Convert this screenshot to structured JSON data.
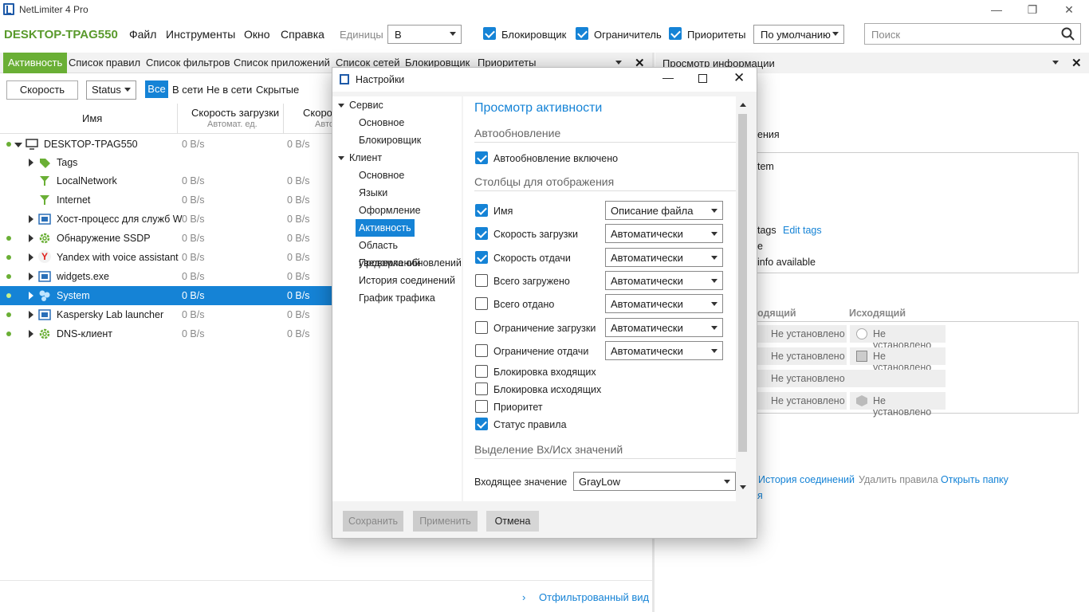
{
  "window": {
    "title": "NetLimiter 4 Pro",
    "min": "—",
    "restore": "❐",
    "close": "✕"
  },
  "menubar": {
    "host": "DESKTOP-TPAG550",
    "menus": [
      "Файл",
      "Инструменты",
      "Окно",
      "Справка"
    ],
    "units_label": "Единицы",
    "units_value": "B",
    "blocker_label": "Блокировщик",
    "limiter_label": "Ограничитель",
    "priorities_label": "Приоритеты",
    "default_value": "По умолчанию",
    "search_placeholder": "Поиск"
  },
  "tabs": [
    "Активность",
    "Список правил",
    "Список фильтров",
    "Список приложений",
    "Список сетей",
    "Блокировщик",
    "Приоритеты"
  ],
  "right_tab": {
    "title": "Просмотр информации"
  },
  "filterbar": {
    "speed": "Скорость",
    "status": "Status",
    "all": "Все",
    "online": "В сети",
    "offline": "Не в сети",
    "hidden": "Скрытые"
  },
  "columns": {
    "name": "Имя",
    "download": "Скорость загрузки",
    "download_sub": "Автомат. ед.",
    "upload": "Скоро",
    "upload_sub": "Авто"
  },
  "rows": [
    {
      "name": "DESKTOP-TPAG550",
      "down": "0 B/s",
      "up": "0 B/s"
    },
    {
      "name": "Tags",
      "down": "",
      "up": ""
    },
    {
      "name": "LocalNetwork",
      "down": "0 B/s",
      "up": "0 B/s"
    },
    {
      "name": "Internet",
      "down": "0 B/s",
      "up": "0 B/s"
    },
    {
      "name": "Хост-процесс для служб W",
      "down": "0 B/s",
      "up": "0 B/s"
    },
    {
      "name": "Обнаружение SSDP",
      "down": "0 B/s",
      "up": "0 B/s"
    },
    {
      "name": "Yandex with voice assistant",
      "down": "0 B/s",
      "up": "0 B/s"
    },
    {
      "name": "widgets.exe",
      "down": "0 B/s",
      "up": "0 B/s"
    },
    {
      "name": "System",
      "down": "0 B/s",
      "up": "0 B/s"
    },
    {
      "name": "Kaspersky Lab launcher",
      "down": "0 B/s",
      "up": "0 B/s"
    },
    {
      "name": "DNS-клиент",
      "down": "0 B/s",
      "up": "0 B/s"
    }
  ],
  "bottom": {
    "filtered_view": "Отфильтрованный вид"
  },
  "info_panel": {
    "partial1": "ения",
    "partial2": "tem",
    "partial3": "tags",
    "edit_tags": "Edit tags",
    "partial4": "e",
    "partial5": "info available",
    "incoming_hdr": "одящий",
    "outgoing_hdr": "Исходящий",
    "not_set": "Не установлено",
    "history": "История соединений",
    "delete_rules": "Удалить правила",
    "open_folder": "Открыть папку",
    "partial6": "я"
  },
  "dialog": {
    "title": "Настройки",
    "tree": {
      "service": "Сервис",
      "service_items": [
        "Основное",
        "Блокировщик"
      ],
      "client": "Клиент",
      "client_items": [
        "Основное",
        "Языки",
        "Оформление",
        "Активность",
        "Область уведомлений",
        "Проверка обновлений",
        "История соединений",
        "График трафика"
      ]
    },
    "heading": "Просмотр активности",
    "autorefresh_section": "Автообновление",
    "autorefresh_label": "Автообновление включено",
    "columns_section": "Столбцы для отображения",
    "columns": [
      {
        "label": "Имя",
        "checked": true,
        "combo": "Описание файла"
      },
      {
        "label": "Скорость загрузки",
        "checked": true,
        "combo": "Автоматически"
      },
      {
        "label": "Скорость отдачи",
        "checked": true,
        "combo": "Автоматически"
      },
      {
        "label": "Всего загружено",
        "checked": false,
        "combo": "Автоматически"
      },
      {
        "label": "Всего отдано",
        "checked": false,
        "combo": "Автоматически"
      },
      {
        "label": "Ограничение загрузки",
        "checked": false,
        "combo": "Автоматически"
      },
      {
        "label": "Ограничение отдачи",
        "checked": false,
        "combo": "Автоматически"
      },
      {
        "label": "Блокировка входящих",
        "checked": false
      },
      {
        "label": "Блокировка исходящих",
        "checked": false
      },
      {
        "label": "Приоритет",
        "checked": false
      },
      {
        "label": "Статус правила",
        "checked": true
      }
    ],
    "highlight_section": "Выделение Вх/Исх значений",
    "incoming_label": "Входящее значение",
    "incoming_value": "GrayLow",
    "save": "Сохранить",
    "apply": "Применить",
    "cancel": "Отмена"
  },
  "colors": {
    "accent": "#1583d6",
    "brand_green": "#6aaf35"
  }
}
